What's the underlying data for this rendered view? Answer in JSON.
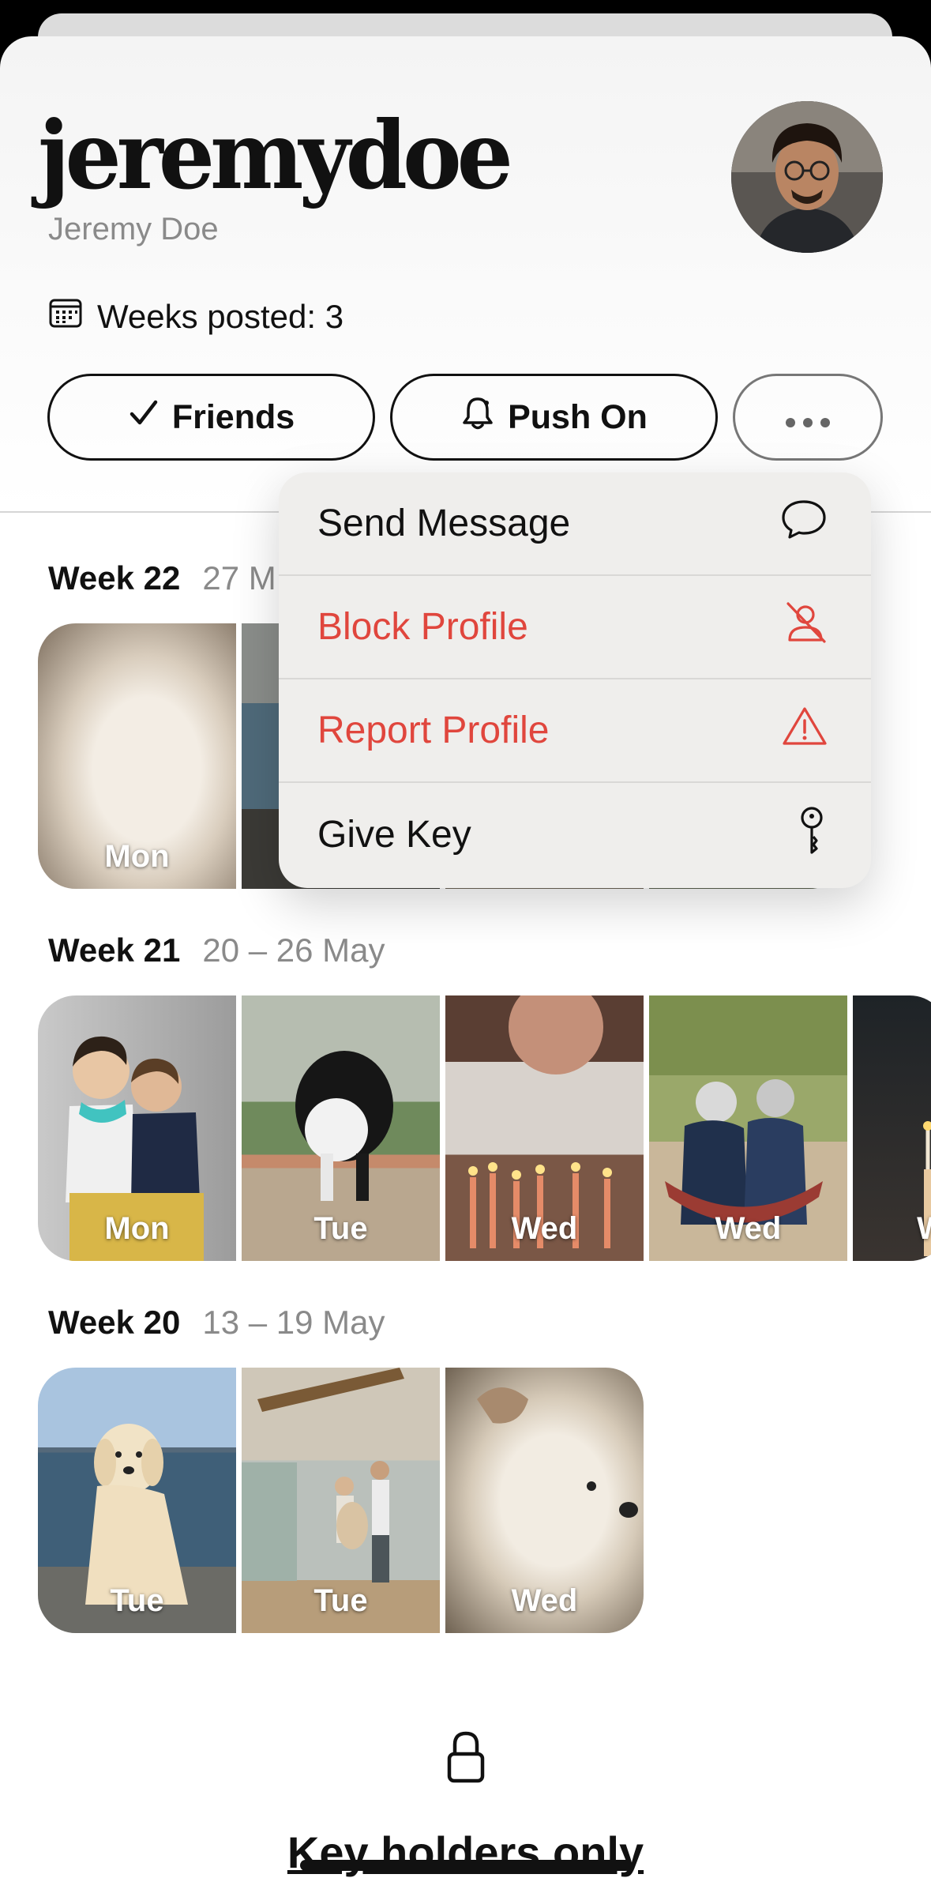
{
  "profile": {
    "username": "jeremydoe",
    "full_name": "Jeremy Doe",
    "weeks_posted": "Weeks posted: 3"
  },
  "actions": {
    "friends_label": "Friends",
    "push_label": "Push On"
  },
  "menu": {
    "items": [
      {
        "label": "Send Message",
        "icon": "speech-bubble-icon",
        "style": "normal"
      },
      {
        "label": "Block Profile",
        "icon": "person-slash-icon",
        "style": "danger"
      },
      {
        "label": "Report Profile",
        "icon": "warning-triangle-icon",
        "style": "danger"
      },
      {
        "label": "Give Key",
        "icon": "key-icon",
        "style": "normal"
      }
    ]
  },
  "weeks": [
    {
      "title": "Week 22",
      "range": "27 M",
      "days": [
        "Mon"
      ]
    },
    {
      "title": "Week 21",
      "range": "20 – 26 May",
      "days": [
        "Mon",
        "Tue",
        "Wed",
        "Wed",
        "W"
      ]
    },
    {
      "title": "Week 20",
      "range": "13 – 19 May",
      "days": [
        "Tue",
        "Tue",
        "Wed"
      ]
    }
  ],
  "footer": {
    "key_holders": "Key holders only"
  },
  "colors": {
    "danger": "#e0463d",
    "secondary_text": "#8a8a8a"
  }
}
